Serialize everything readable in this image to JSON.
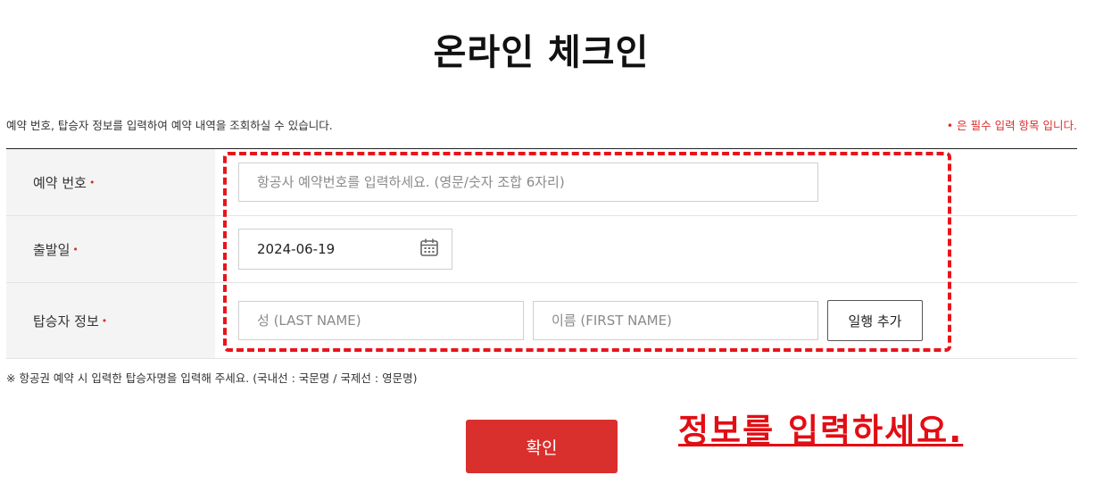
{
  "page": {
    "title": "온라인 체크인"
  },
  "intro": {
    "text": "예약 번호, 탑승자 정보를 입력하여 예약 내역을 조회하실 수 있습니다.",
    "required_note": "• 은 필수 입력 항목 입니다."
  },
  "form": {
    "required_marker": "•",
    "booking": {
      "label": "예약 번호",
      "placeholder": "항공사 예약번호를 입력하세요. (영문/숫자 조합 6자리)",
      "value": ""
    },
    "departure": {
      "label": "출발일",
      "value": "2024-06-19",
      "icon": "calendar-icon"
    },
    "passenger": {
      "label": "탑승자 정보",
      "last_name_placeholder": "성 (LAST NAME)",
      "first_name_placeholder": "이름 (FIRST NAME)",
      "add_button": "일행 추가"
    }
  },
  "notice": "※ 항공권 예약 시 입력한 탑승자명을 입력해 주세요. (국내선 : 국문명 / 국제선 : 영문명)",
  "confirm_button": "확인",
  "annotation": "정보를 입력하세요.",
  "colors": {
    "accent": "#d9302d",
    "highlight": "#e8141b",
    "label_bg": "#f4f4f4"
  }
}
